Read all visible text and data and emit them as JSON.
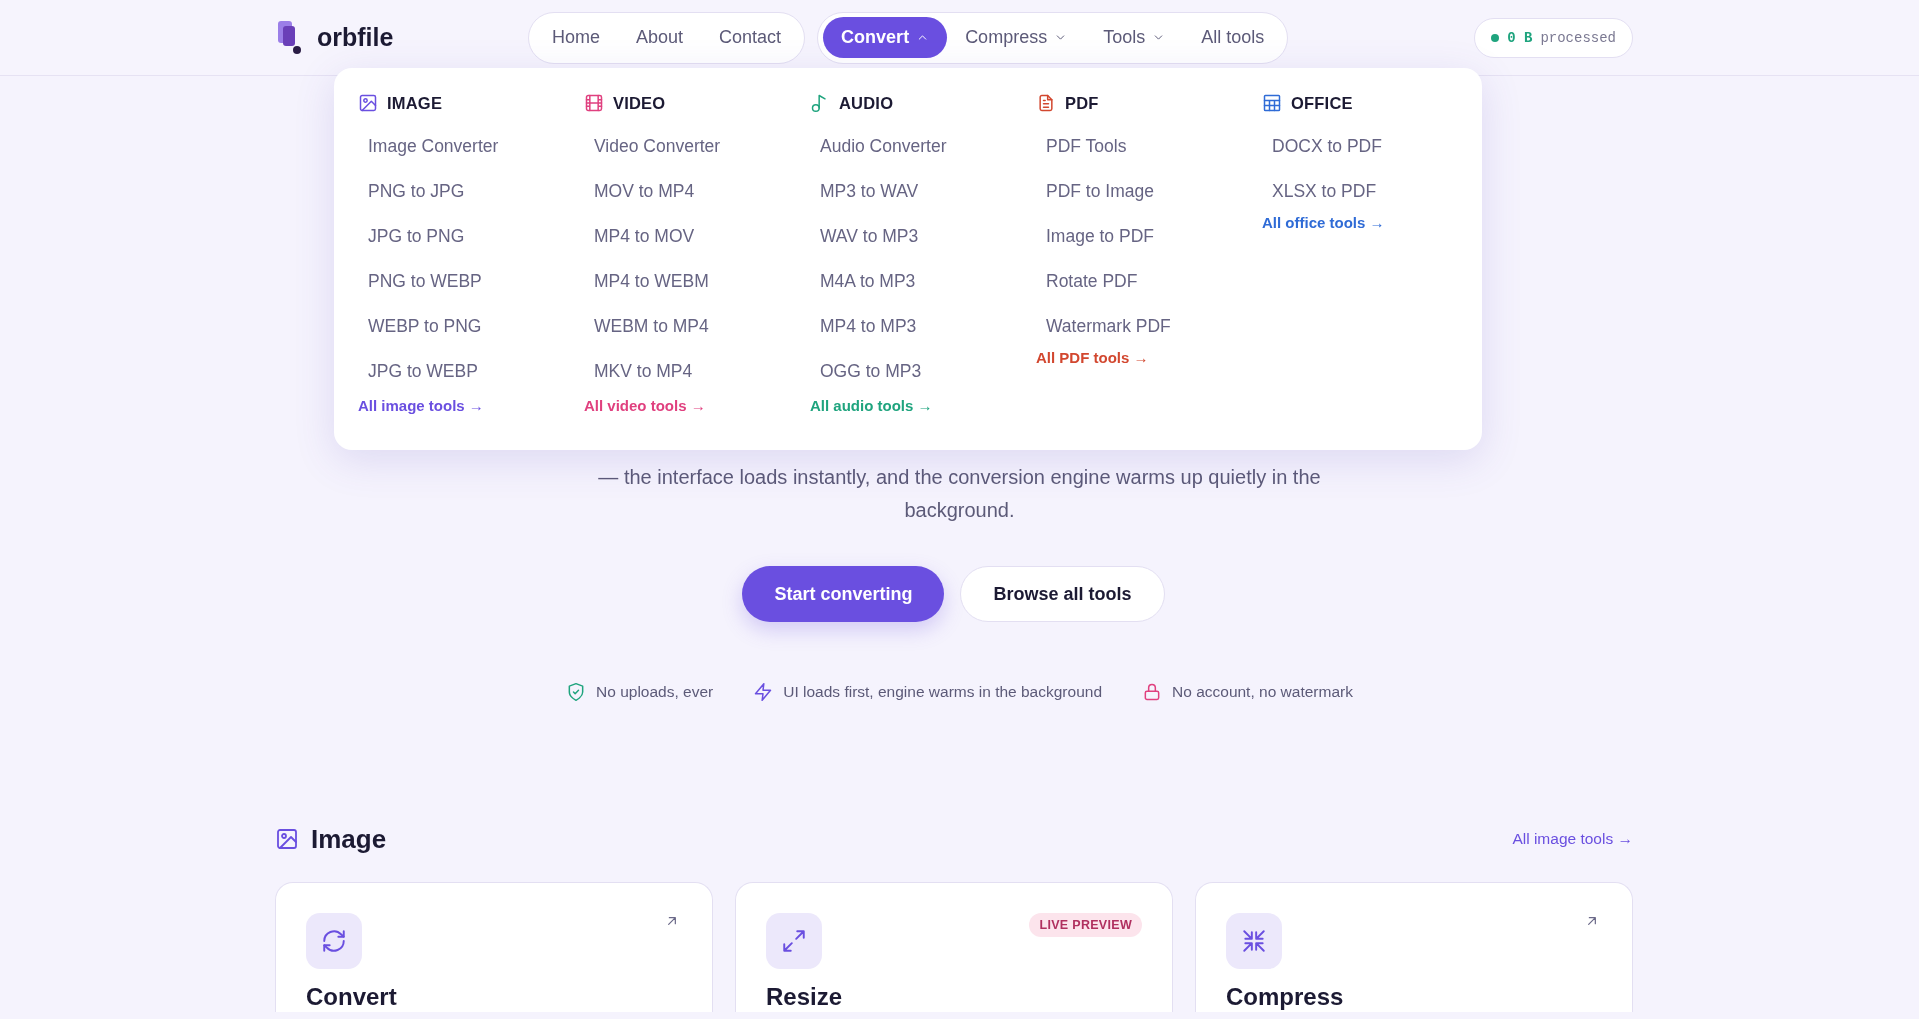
{
  "brand": {
    "name": "orbfile"
  },
  "nav_primary": [
    {
      "label": "Home"
    },
    {
      "label": "About"
    },
    {
      "label": "Contact"
    }
  ],
  "nav_tools": [
    {
      "label": "Convert",
      "kind": "menu",
      "selected": true,
      "expanded": true
    },
    {
      "label": "Compress",
      "kind": "menu",
      "selected": false,
      "expanded": false
    },
    {
      "label": "Tools",
      "kind": "menu",
      "selected": false,
      "expanded": false
    },
    {
      "label": "All tools",
      "kind": "link",
      "selected": false
    }
  ],
  "status": {
    "value": "0 B",
    "label": "processed"
  },
  "mega_menu": {
    "columns": [
      {
        "kind": "image",
        "title": "IMAGE",
        "color": "#6a4fe0",
        "items": [
          "Image Converter",
          "PNG to JPG",
          "JPG to PNG",
          "PNG to WEBP",
          "WEBP to PNG",
          "JPG to WEBP"
        ],
        "link": "All image tools →"
      },
      {
        "kind": "video",
        "title": "VIDEO",
        "color": "#e0407f",
        "items": [
          "Video Converter",
          "MOV to MP4",
          "MP4 to MOV",
          "MP4 to WEBM",
          "WEBM to MP4",
          "MKV to MP4"
        ],
        "link": "All video tools →"
      },
      {
        "kind": "audio",
        "title": "AUDIO",
        "color": "#1fa47e",
        "items": [
          "Audio Converter",
          "MP3 to WAV",
          "WAV to MP3",
          "M4A to MP3",
          "MP4 to MP3",
          "OGG to MP3"
        ],
        "link": "All audio tools →"
      },
      {
        "kind": "pdf",
        "title": "PDF",
        "color": "#d2472f",
        "items": [
          "PDF Tools",
          "PDF to Image",
          "Image to PDF",
          "Rotate PDF",
          "Watermark PDF"
        ],
        "link": "All PDF tools →"
      },
      {
        "kind": "office",
        "title": "OFFICE",
        "color": "#2f6bd6",
        "items": [
          "DOCX to PDF",
          "XLSX to PDF"
        ],
        "link": "All office tools →"
      }
    ]
  },
  "hero": {
    "description": "— the interface loads instantly, and the conversion engine warms up quietly in the background.",
    "buttons": [
      {
        "label": "Start converting",
        "kind": "primary"
      },
      {
        "label": "Browse all tools",
        "kind": "secondary"
      }
    ],
    "features": [
      {
        "kind": "shield",
        "text": "No uploads, ever"
      },
      {
        "kind": "bolt",
        "text": "UI loads first, engine warms in the background"
      },
      {
        "kind": "lock",
        "text": "No account, no watermark"
      }
    ]
  },
  "section": {
    "title": "Image",
    "link": "All image tools →",
    "cards": [
      {
        "kind": "convert",
        "title": "Convert"
      },
      {
        "kind": "resize",
        "title": "Resize",
        "badge": "LIVE PREVIEW"
      },
      {
        "kind": "compress",
        "title": "Compress"
      }
    ]
  }
}
